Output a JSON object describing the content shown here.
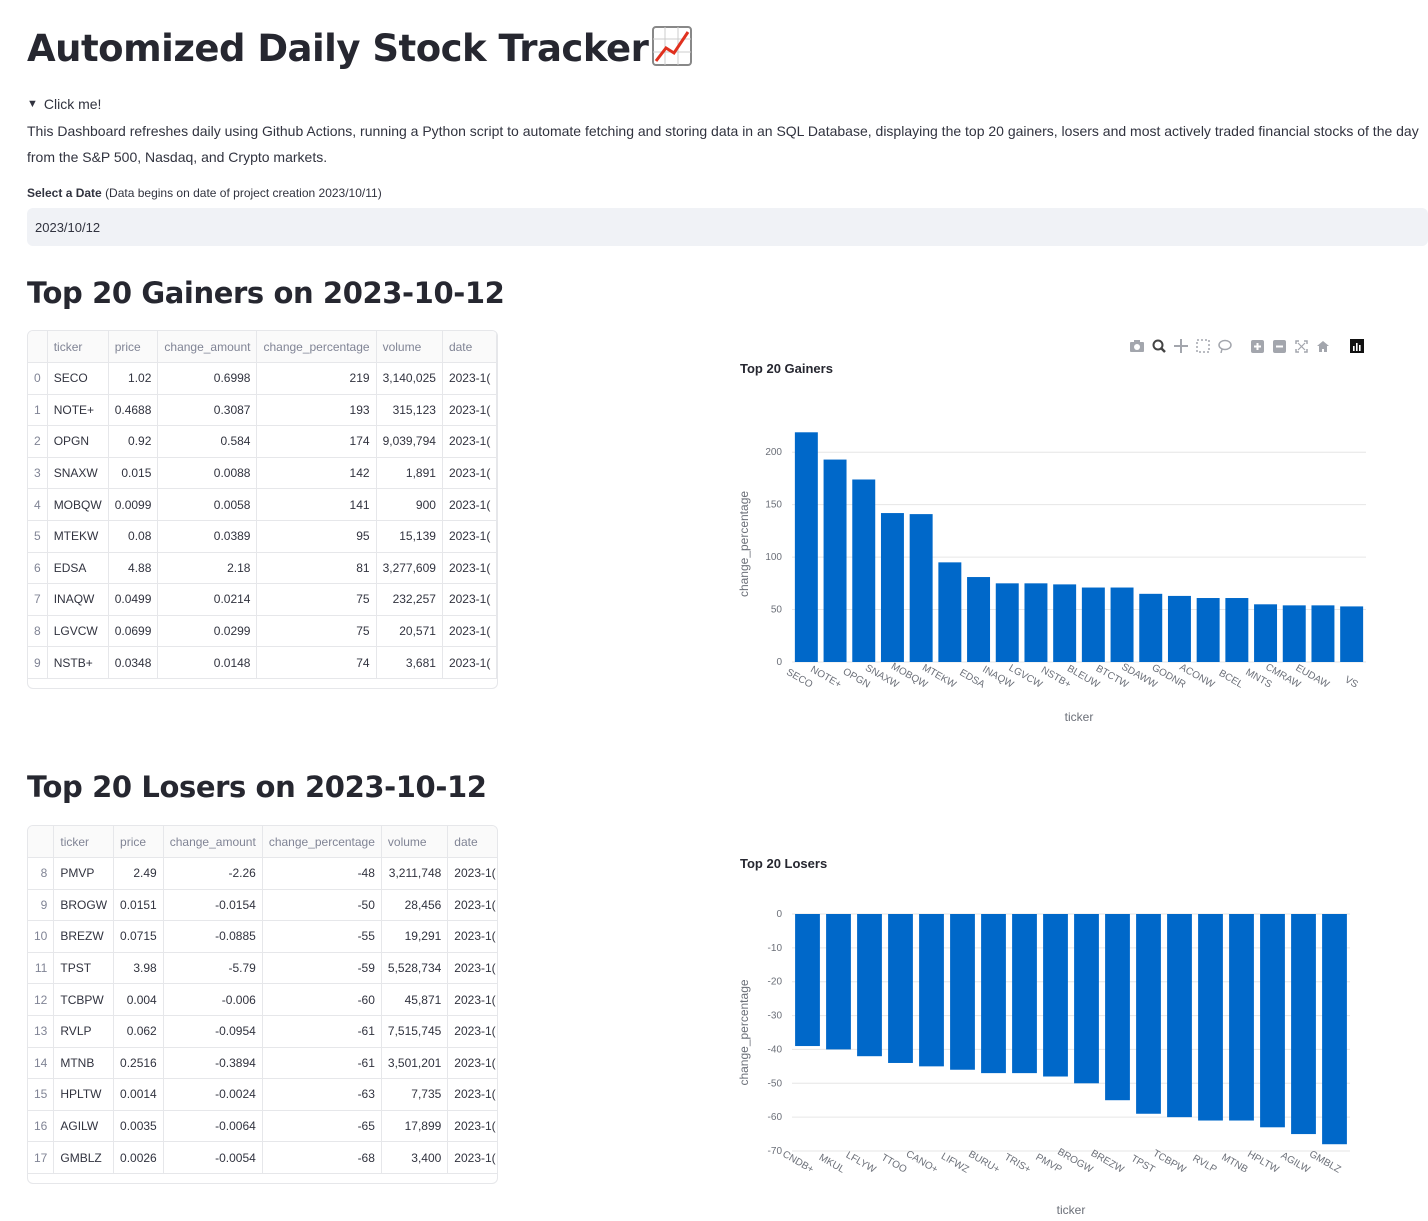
{
  "app": {
    "title": "Automized Daily Stock Tracker",
    "expander_label": "Click me!",
    "description": "This Dashboard refreshes daily using Github Actions, running a Python script to automate fetching and storing data in an SQL Database, displaying the top 20 gainers, losers and most actively traded financial stocks of the day from the S&P 500, Nasdaq, and Crypto markets.",
    "date_label_bold": "Select a Date",
    "date_label_note": "(Data begins on date of project creation 2023/10/11)",
    "date_value": "2023/10/12"
  },
  "gainers": {
    "heading": "Top 20 Gainers on 2023-10-12",
    "columns": [
      "",
      "ticker",
      "price",
      "change_amount",
      "change_percentage",
      "volume",
      "date"
    ],
    "rows": [
      [
        "0",
        "SECO",
        "1.02",
        "0.6998",
        "219",
        "3,140,025",
        "2023-1("
      ],
      [
        "1",
        "NOTE+",
        "0.4688",
        "0.3087",
        "193",
        "315,123",
        "2023-1("
      ],
      [
        "2",
        "OPGN",
        "0.92",
        "0.584",
        "174",
        "9,039,794",
        "2023-1("
      ],
      [
        "3",
        "SNAXW",
        "0.015",
        "0.0088",
        "142",
        "1,891",
        "2023-1("
      ],
      [
        "4",
        "MOBQW",
        "0.0099",
        "0.0058",
        "141",
        "900",
        "2023-1("
      ],
      [
        "5",
        "MTEKW",
        "0.08",
        "0.0389",
        "95",
        "15,139",
        "2023-1("
      ],
      [
        "6",
        "EDSA",
        "4.88",
        "2.18",
        "81",
        "3,277,609",
        "2023-1("
      ],
      [
        "7",
        "INAQW",
        "0.0499",
        "0.0214",
        "75",
        "232,257",
        "2023-1("
      ],
      [
        "8",
        "LGVCW",
        "0.0699",
        "0.0299",
        "75",
        "20,571",
        "2023-1("
      ],
      [
        "9",
        "NSTB+",
        "0.0348",
        "0.0148",
        "74",
        "3,681",
        "2023-1("
      ]
    ]
  },
  "losers": {
    "heading": "Top 20 Losers on 2023-10-12",
    "columns": [
      "",
      "ticker",
      "price",
      "change_amount",
      "change_percentage",
      "volume",
      "date"
    ],
    "rows": [
      [
        "8",
        "PMVP",
        "2.49",
        "-2.26",
        "-48",
        "3,211,748",
        "2023-1("
      ],
      [
        "9",
        "BROGW",
        "0.0151",
        "-0.0154",
        "-50",
        "28,456",
        "2023-1("
      ],
      [
        "10",
        "BREZW",
        "0.0715",
        "-0.0885",
        "-55",
        "19,291",
        "2023-1("
      ],
      [
        "11",
        "TPST",
        "3.98",
        "-5.79",
        "-59",
        "5,528,734",
        "2023-1("
      ],
      [
        "12",
        "TCBPW",
        "0.004",
        "-0.006",
        "-60",
        "45,871",
        "2023-1("
      ],
      [
        "13",
        "RVLP",
        "0.062",
        "-0.0954",
        "-61",
        "7,515,745",
        "2023-1("
      ],
      [
        "14",
        "MTNB",
        "0.2516",
        "-0.3894",
        "-61",
        "3,501,201",
        "2023-1("
      ],
      [
        "15",
        "HPLTW",
        "0.0014",
        "-0.0024",
        "-63",
        "7,735",
        "2023-1("
      ],
      [
        "16",
        "AGILW",
        "0.0035",
        "-0.0064",
        "-65",
        "17,899",
        "2023-1("
      ],
      [
        "17",
        "GMBLZ",
        "0.0026",
        "-0.0054",
        "-68",
        "3,400",
        "2023-1("
      ]
    ]
  },
  "chart_data": [
    {
      "type": "bar",
      "title": "Top 20 Gainers",
      "xlabel": "ticker",
      "ylabel": "change_percentage",
      "ylim": [
        0,
        225
      ],
      "yticks": [
        0,
        50,
        100,
        150,
        200
      ],
      "color": "#0068c9",
      "categories": [
        "SECO",
        "NOTE+",
        "OPGN",
        "SNAXW",
        "MOBQW",
        "MTEKW",
        "EDSA",
        "INAQW",
        "LGVCW",
        "NSTB+",
        "BLEUW",
        "BTCTW",
        "SDAWW",
        "GODNR",
        "ACONW",
        "BCEL",
        "MNTS",
        "CMRAW",
        "EUDAW",
        "VS"
      ],
      "values": [
        219,
        193,
        174,
        142,
        141,
        95,
        81,
        75,
        75,
        74,
        71,
        71,
        65,
        63,
        61,
        61,
        55,
        54,
        54,
        53
      ]
    },
    {
      "type": "bar",
      "title": "Top 20 Losers",
      "xlabel": "ticker",
      "ylabel": "change_percentage",
      "ylim": [
        -70,
        0
      ],
      "yticks": [
        0,
        -10,
        -20,
        -30,
        -40,
        -50,
        -60,
        -70
      ],
      "color": "#0068c9",
      "categories": [
        "CNDB+",
        "MKUL",
        "LFLYW",
        "TTOO",
        "CANO+",
        "LIFWZ",
        "BURU+",
        "TRIS+",
        "PMVP",
        "BROGW",
        "BREZW",
        "TPST",
        "TCBPW",
        "RVLP",
        "MTNB",
        "HPLTW",
        "AGILW",
        "GMBLZ"
      ],
      "values": [
        -39,
        -40,
        -42,
        -44,
        -45,
        -46,
        -47,
        -47,
        -48,
        -50,
        -55,
        -59,
        -60,
        -61,
        -61,
        -63,
        -65,
        -68
      ]
    }
  ],
  "modebar": [
    "camera-icon",
    "zoom-icon",
    "pan-icon",
    "box-select-icon",
    "lasso-icon",
    "zoom-in-icon",
    "zoom-out-icon",
    "autoscale-icon",
    "reset-axes-icon",
    "plotly-logo-icon"
  ]
}
